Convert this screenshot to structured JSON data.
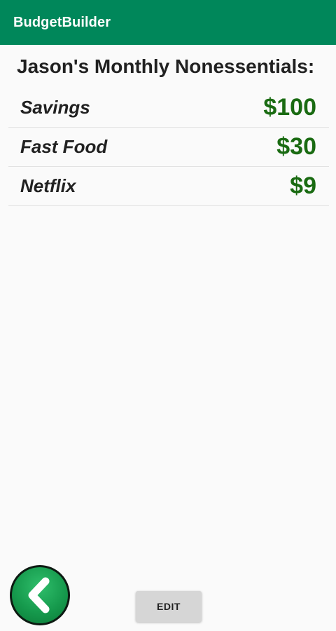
{
  "app_bar": {
    "title": "BudgetBuilder",
    "color": "#00875a"
  },
  "heading": "Jason's Monthly Nonessentials:",
  "items": [
    {
      "label": "Savings",
      "value": "$100"
    },
    {
      "label": "Fast Food",
      "value": "$30"
    },
    {
      "label": "Netflix",
      "value": "$9"
    }
  ],
  "colors": {
    "value_text": "#1a6b12",
    "back_button": "#169a4d"
  },
  "back_button": {
    "icon": "chevron-left-icon"
  },
  "edit_button": {
    "label": "EDIT"
  }
}
